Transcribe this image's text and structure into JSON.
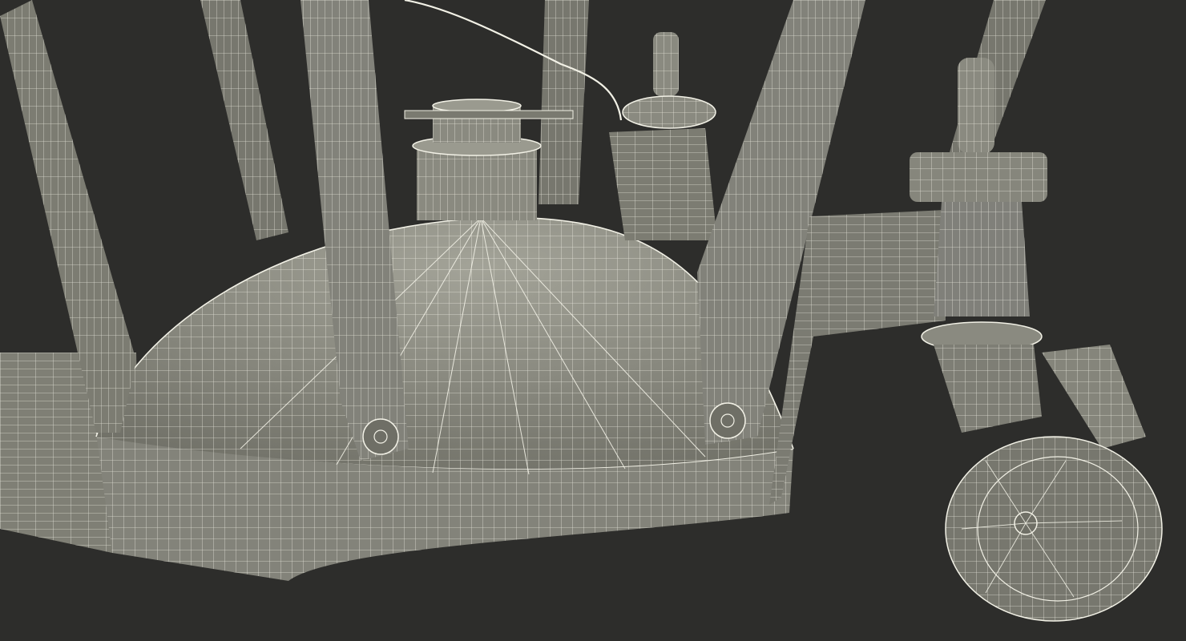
{
  "scene": {
    "subject": "wireframe-3d-model",
    "colors": {
      "background": "#2d2d2b",
      "surface": "#85857a",
      "surface_dark": "#6e6e65",
      "surface_light": "#9a9a8f",
      "wire": "#f2f1e6"
    }
  }
}
